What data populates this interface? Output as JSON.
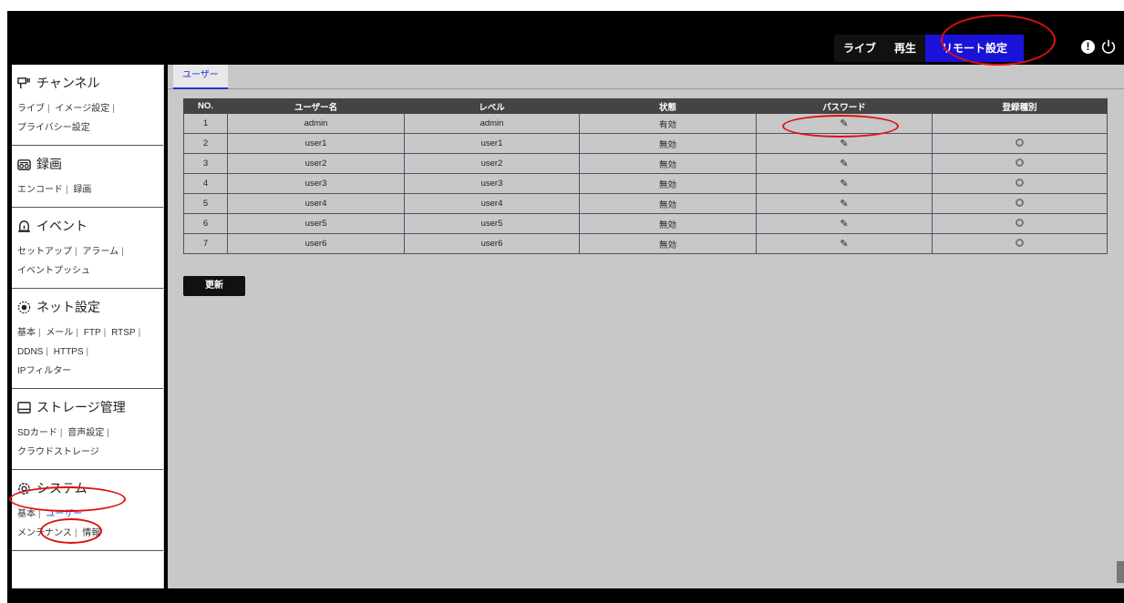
{
  "topnav": {
    "live": "ライブ",
    "playback": "再生",
    "remote_settings": "リモート設定",
    "active_color": "#1a12d8"
  },
  "top_icons": {
    "alert": "!",
    "alert_icon": "alert-icon",
    "power_icon": "power-icon"
  },
  "sidebar": {
    "sections": [
      {
        "icon": "channel-icon",
        "title": "チャンネル",
        "links": [
          "ライブ",
          "イメージ設定",
          "プライバシー設定"
        ]
      },
      {
        "icon": "record-icon",
        "title": "録画",
        "links": [
          "エンコード",
          "録画"
        ]
      },
      {
        "icon": "event-icon",
        "title": "イベント",
        "links": [
          "セットアップ",
          "アラーム",
          "イベントプッシュ"
        ]
      },
      {
        "icon": "network-icon",
        "title": "ネット設定",
        "links": [
          "基本",
          "メール",
          "FTP",
          "RTSP",
          "DDNS",
          "HTTPS",
          "IPフィルター"
        ]
      },
      {
        "icon": "storage-icon",
        "title": "ストレージ管理",
        "links": [
          "SDカード",
          "音声設定",
          "クラウドストレージ"
        ]
      },
      {
        "icon": "system-icon",
        "title": "システム",
        "links": [
          "基本",
          "ユーザー",
          "メンテナンス",
          "情報"
        ]
      }
    ],
    "active_link_color": "#2a36d6"
  },
  "main": {
    "tab": "ユーザー",
    "table": {
      "headers": [
        "NO.",
        "ユーザー名",
        "レベル",
        "状態",
        "パスワード",
        "登録種別"
      ],
      "rows": [
        [
          "1",
          "admin",
          "admin",
          "有効"
        ],
        [
          "2",
          "user1",
          "user1",
          "無効"
        ],
        [
          "3",
          "user2",
          "user2",
          "無効"
        ],
        [
          "4",
          "user3",
          "user3",
          "無効"
        ],
        [
          "5",
          "user4",
          "user4",
          "無効"
        ],
        [
          "6",
          "user5",
          "user5",
          "無効"
        ],
        [
          "7",
          "user6",
          "user6",
          "無効"
        ]
      ]
    },
    "refresh_button": "更新"
  },
  "annotation_color": "#e01010"
}
